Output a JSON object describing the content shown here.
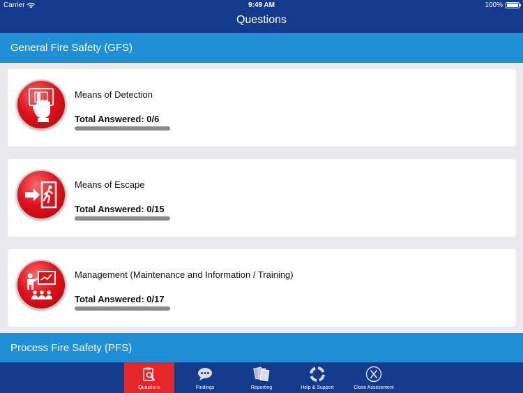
{
  "status_bar": {
    "carrier": "Carrier",
    "time": "9:49 AM",
    "battery": "100%"
  },
  "nav": {
    "title": "Questions"
  },
  "sections": [
    {
      "title": "General Fire Safety (GFS)"
    },
    {
      "title": "Process Fire Safety (PFS)"
    }
  ],
  "cards": [
    {
      "title": "Means of Detection",
      "total": "Total Answered: 0/6",
      "progress": 0,
      "icon": "detection-icon"
    },
    {
      "title": "Means of Escape",
      "total": "Total Answered: 0/15",
      "progress": 0,
      "icon": "escape-icon"
    },
    {
      "title": "Management (Maintenance and Information / Training)",
      "total": "Total Answered: 0/17",
      "progress": 0,
      "icon": "management-icon"
    }
  ],
  "tabs": [
    {
      "label": "Questions",
      "icon": "questions-icon",
      "active": true
    },
    {
      "label": "Findings",
      "icon": "findings-icon",
      "active": false
    },
    {
      "label": "Reporting",
      "icon": "reporting-icon",
      "active": false
    },
    {
      "label": "Help & Support",
      "icon": "help-icon",
      "active": false
    },
    {
      "label": "Close Assessment",
      "icon": "close-icon",
      "active": false
    }
  ],
  "colors": {
    "nav": "#143a8c",
    "section": "#1f8fd6",
    "active_tab": "#e3262c",
    "icon_red": "#e0121c"
  }
}
